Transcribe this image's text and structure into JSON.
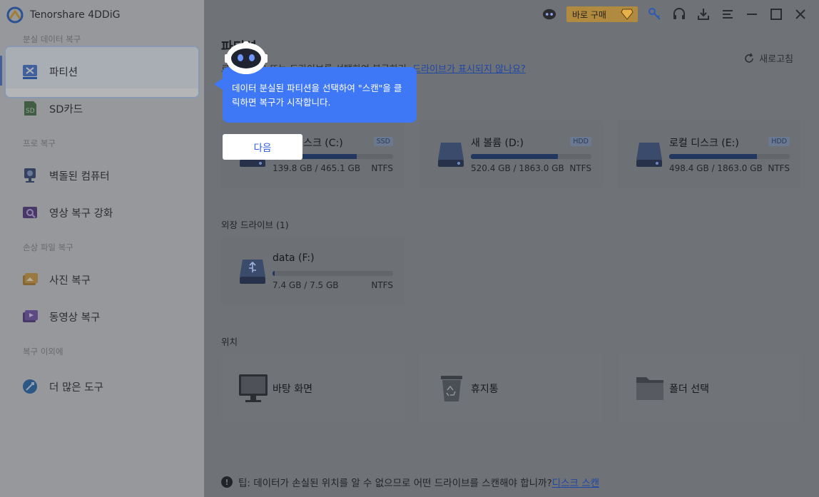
{
  "app": {
    "name": "Tenorshare 4DDiG"
  },
  "sidebar": {
    "sections": [
      {
        "header": "분실 데이터 복구",
        "items": [
          {
            "label": "파티션",
            "icon": "partition-icon",
            "active": true
          },
          {
            "label": "SD카드",
            "icon": "sd-card-icon"
          }
        ]
      },
      {
        "header": "프로 복구",
        "items": [
          {
            "label": "벽돌된 컴퓨터",
            "icon": "crashed-computer-icon"
          },
          {
            "label": "영상 복구 강화",
            "icon": "video-repair-icon"
          }
        ]
      },
      {
        "header": "손상 파일 복구",
        "items": [
          {
            "label": "사진 복구",
            "icon": "photo-repair-icon"
          },
          {
            "label": "동영상 복구",
            "icon": "video-icon"
          }
        ]
      },
      {
        "header": "복구 이외에",
        "items": [
          {
            "label": "더 많은 도구",
            "icon": "more-tools-icon"
          }
        ]
      }
    ]
  },
  "titlebar": {
    "buy_label": "바로 구매"
  },
  "main": {
    "title": "파티션",
    "subtitle_prefix": "로컬 디스크 또는 드라이브를 선택하여 복구하기.",
    "subtitle_link": "드라이브가 표시되지 않나요?",
    "refresh_label": "새로고침",
    "local_drives": [
      {
        "name": "로컬 디스크 (C:)",
        "type": "SSD",
        "used": "139.8 GB",
        "total": "465.1 GB",
        "size_text": "139.8 GB / 465.1 GB",
        "fs": "NTFS",
        "fill": 0.7
      },
      {
        "name": "새 볼륨 (D:)",
        "type": "HDD",
        "used": "520.4 GB",
        "total": "1863.0 GB",
        "size_text": "520.4 GB / 1863.0 GB",
        "fs": "NTFS",
        "fill": 0.72
      },
      {
        "name": "로컬 디스크 (E:)",
        "type": "HDD",
        "used": "498.4 GB",
        "total": "1863.0 GB",
        "size_text": "498.4 GB / 1863.0 GB",
        "fs": "NTFS",
        "fill": 0.73
      }
    ],
    "external_header": "외장 드라이브 (1)",
    "external_drives": [
      {
        "name": "data (F:)",
        "size_text": "7.4 GB / 7.5 GB",
        "fs": "NTFS",
        "fill": 0.02
      }
    ],
    "location_header": "위치",
    "locations": [
      {
        "label": "바탕 화면",
        "icon": "desktop-icon"
      },
      {
        "label": "휴지통",
        "icon": "recycle-bin-icon"
      },
      {
        "label": "폴더 선택",
        "icon": "folder-icon"
      }
    ],
    "tip_text": "팁: 데이터가 손실된 위치를 알 수 없으므로 어떤 드라이브를 스캔해야 합니까?",
    "tip_link": "디스크 스캔"
  },
  "guide": {
    "message_line1": "데이터 분실된 파티션을 선택하여 \"스캔\"을 클",
    "message_line2": "릭하면 복구가 시작합니다.",
    "next_label": "다음"
  },
  "colors": {
    "accent": "#3f78f6",
    "brand_gold": "#b08a3e",
    "link": "#1e47a6"
  }
}
